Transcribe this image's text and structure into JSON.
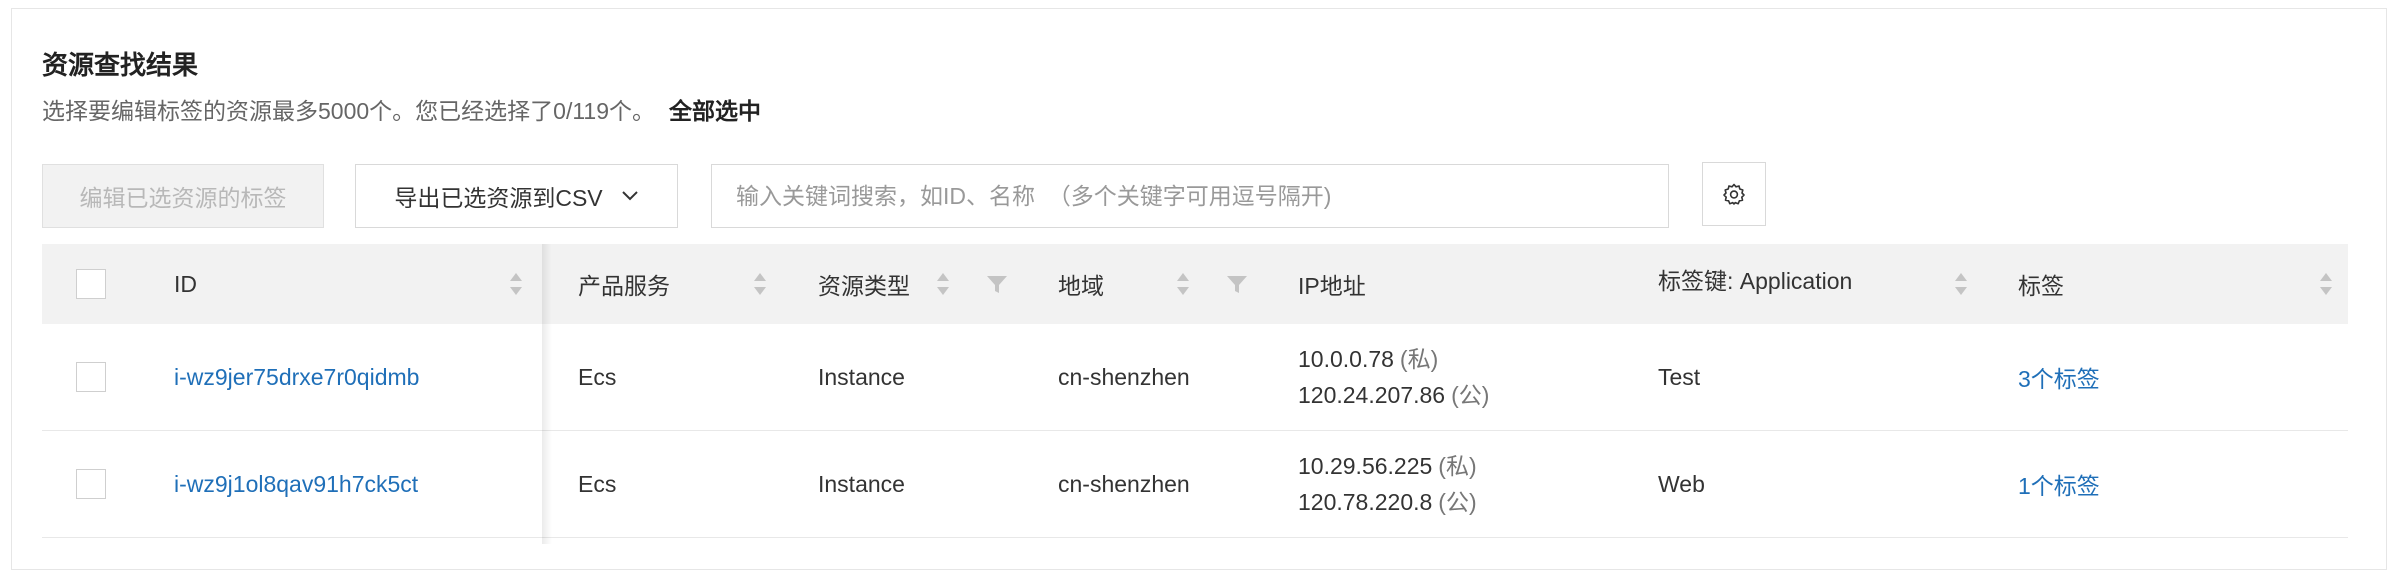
{
  "header": {
    "title": "资源查找结果",
    "subtitle": "选择要编辑标签的资源最多5000个。您已经选择了0/119个。",
    "select_all": "全部选中"
  },
  "toolbar": {
    "edit_tags_label": "编辑已选资源的标签",
    "export_label": "导出已选资源到CSV",
    "search_placeholder": "输入关键词搜索，如ID、名称  （多个关键字可用逗号隔开)"
  },
  "table": {
    "columns": {
      "id": "ID",
      "product": "产品服务",
      "type": "资源类型",
      "region": "地域",
      "ip": "IP地址",
      "tag_key": "标签键: Application",
      "tags": "标签"
    },
    "rows": [
      {
        "id": "i-wz9jer75drxe7r0qidmb",
        "product": "Ecs",
        "type": "Instance",
        "region": "cn-shenzhen",
        "ip_private": "10.0.0.78",
        "ip_private_tag": "(私)",
        "ip_public": "120.24.207.86",
        "ip_public_tag": "(公)",
        "tag_key_value": "Test",
        "tags": "3个标签"
      },
      {
        "id": "i-wz9j1ol8qav91h7ck5ct",
        "product": "Ecs",
        "type": "Instance",
        "region": "cn-shenzhen",
        "ip_private": "10.29.56.225",
        "ip_private_tag": "(私)",
        "ip_public": "120.78.220.8",
        "ip_public_tag": "(公)",
        "tag_key_value": "Web",
        "tags": "1个标签"
      }
    ]
  },
  "icons": {
    "dropdown": "chevron-down-icon",
    "settings": "gear-icon",
    "sort": "sort-icon",
    "filter": "filter-icon"
  },
  "colors": {
    "link": "#1f6fb8",
    "header_bg": "#f2f2f2",
    "disabled_bg": "#f2f2f2"
  }
}
